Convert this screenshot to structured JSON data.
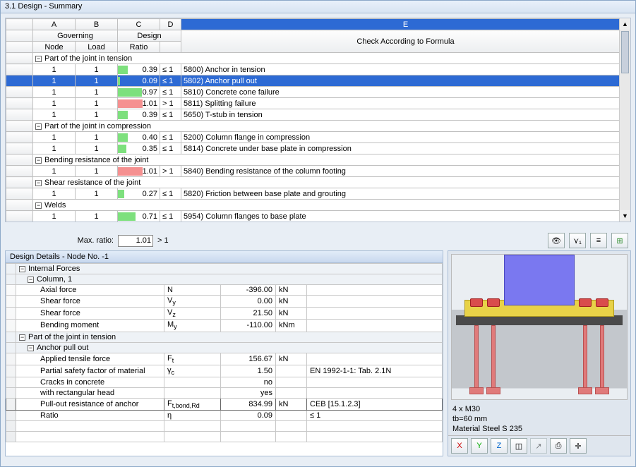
{
  "window": {
    "title": "3.1 Design - Summary"
  },
  "columns": {
    "letters": [
      "A",
      "B",
      "C",
      "D",
      "E"
    ],
    "group1": "Governing",
    "group2": "Design",
    "A": "Node",
    "B": "Load",
    "C": "Ratio",
    "E": "Check According to Formula"
  },
  "tree_minus": "−",
  "sections": [
    {
      "title": "Part of the joint in tension",
      "rows": [
        {
          "node": "1",
          "load": "1",
          "ratio": 0.39,
          "cmp": "≤ 1",
          "desc": "5800) Anchor in tension",
          "bar": "#7de07d"
        },
        {
          "node": "1",
          "load": "1",
          "ratio": 0.09,
          "cmp": "≤ 1",
          "desc": "5802) Anchor pull out",
          "bar": "#7de07d",
          "selected": true
        },
        {
          "node": "1",
          "load": "1",
          "ratio": 0.97,
          "cmp": "≤ 1",
          "desc": "5810) Concrete cone failure",
          "bar": "#7de07d"
        },
        {
          "node": "1",
          "load": "1",
          "ratio": 1.01,
          "cmp": "> 1",
          "desc": "5811) Splitting failure",
          "bar": "#f59090"
        },
        {
          "node": "1",
          "load": "1",
          "ratio": 0.39,
          "cmp": "≤ 1",
          "desc": "5650) T-stub in tension",
          "bar": "#7de07d"
        }
      ]
    },
    {
      "title": "Part of the joint in compression",
      "rows": [
        {
          "node": "1",
          "load": "1",
          "ratio": 0.4,
          "cmp": "≤ 1",
          "desc": "5200) Column flange in compression",
          "bar": "#7de07d"
        },
        {
          "node": "1",
          "load": "1",
          "ratio": 0.35,
          "cmp": "≤ 1",
          "desc": "5814) Concrete under base plate in compression",
          "bar": "#7de07d"
        }
      ]
    },
    {
      "title": "Bending resistance of the joint",
      "rows": [
        {
          "node": "1",
          "load": "1",
          "ratio": 1.01,
          "cmp": "> 1",
          "desc": "5840) Bending resistance of the column footing",
          "bar": "#f59090"
        }
      ]
    },
    {
      "title": "Shear resistance of the joint",
      "rows": [
        {
          "node": "1",
          "load": "1",
          "ratio": 0.27,
          "cmp": "≤ 1",
          "desc": "5820) Friction between base plate and grouting",
          "bar": "#7de07d"
        }
      ]
    },
    {
      "title": "Welds",
      "rows": [
        {
          "node": "1",
          "load": "1",
          "ratio": 0.71,
          "cmp": "≤ 1",
          "desc": "5954) Column flanges to base plate",
          "bar": "#7de07d"
        }
      ]
    }
  ],
  "maxratio": {
    "label": "Max. ratio:",
    "value": "1.01",
    "cmp": "> 1"
  },
  "details": {
    "title": "Design Details  -  Node No. -1",
    "groups": [
      {
        "label": "Internal Forces",
        "indent": 0
      },
      {
        "label": "Column, 1",
        "indent": 1
      }
    ],
    "rows_internal": [
      {
        "label": "Axial force",
        "sym": "N",
        "val": "-396.00",
        "unit": "kN"
      },
      {
        "label": "Shear force",
        "sym": "V<sub>y</sub>",
        "val": "0.00",
        "unit": "kN"
      },
      {
        "label": "Shear force",
        "sym": "V<sub>z</sub>",
        "val": "21.50",
        "unit": "kN"
      },
      {
        "label": "Bending moment",
        "sym": "M<sub>y</sub>",
        "val": "-110.00",
        "unit": "kNm"
      }
    ],
    "group2": "Part of the joint in tension",
    "group3": "Anchor pull out",
    "rows_anchor": [
      {
        "label": "Applied tensile force",
        "sym": "F<sub>t</sub>",
        "val": "156.67",
        "unit": "kN",
        "ref": ""
      },
      {
        "label": "Partial safety factor of material",
        "sym": "γ<sub>c</sub>",
        "val": "1.50",
        "unit": "",
        "ref": "EN 1992-1-1: Tab. 2.1N"
      },
      {
        "label": "Cracks in concrete",
        "sym": "",
        "val": "no",
        "unit": "",
        "ref": ""
      },
      {
        "label": "with rectangular head",
        "sym": "",
        "val": "yes",
        "unit": "",
        "ref": ""
      },
      {
        "label": "Pull-out resistance of anchor",
        "sym": "F<sub>t,bond,Rd</sub>",
        "val": "834.99",
        "unit": "kN",
        "ref": "CEB [15.1.2.3]",
        "selected": true
      },
      {
        "label": "Ratio",
        "sym": "η",
        "val": "0.09",
        "unit": "",
        "ref": "≤ 1"
      }
    ]
  },
  "viewer": {
    "line1": "4 x M30",
    "line2": "tb=60 mm",
    "line3": "Material Steel S 235"
  },
  "icons": {
    "eye": "👁",
    "filter": "⋎₁",
    "bars": "≡",
    "excel": "⊞",
    "axis_x": "X",
    "axis_y": "Y",
    "axis_z": "Z",
    "cube": "◫",
    "arrow": "↗",
    "print": "⎙",
    "axes": "✛"
  }
}
